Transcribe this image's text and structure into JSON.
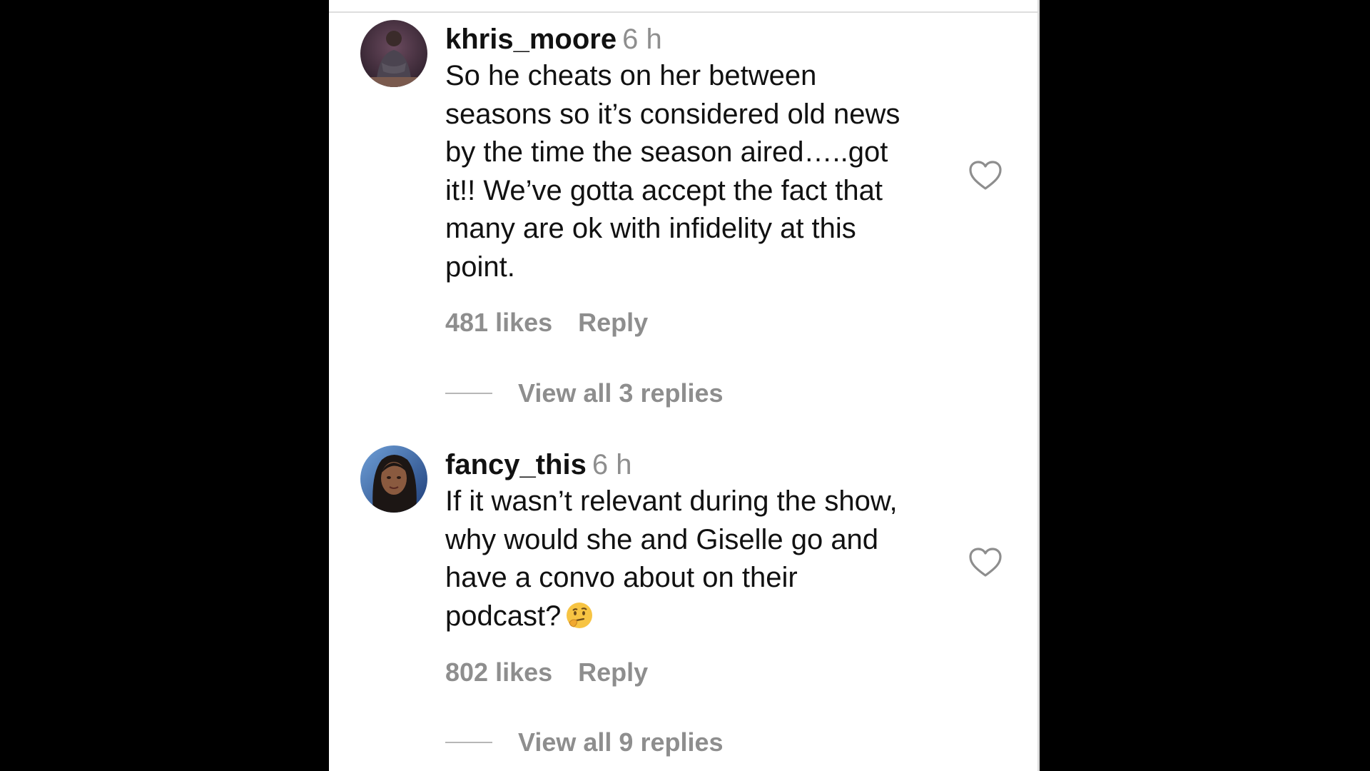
{
  "comments": [
    {
      "username": "khris_moore",
      "time": "6 h",
      "text_lines": [
        "So he cheats on her between",
        "seasons so it’s considered old news",
        "by the time the season aired…..got",
        "it!! We’ve gotta accept the fact that",
        "many are ok with infidelity at this",
        "point."
      ],
      "likes": "481 likes",
      "reply_label": "Reply",
      "view_replies": "View all 3 replies"
    },
    {
      "username": "fancy_this",
      "time": "6 h",
      "text_lines": [
        "If it wasn’t relevant during the show,",
        "why would she and Giselle go and",
        "have a convo about on their",
        "podcast?"
      ],
      "emoji": "thinking-face-emoji",
      "likes": "802 likes",
      "reply_label": "Reply",
      "view_replies": "View all 9 replies"
    }
  ],
  "icons": {
    "like": "heart-outline-icon"
  },
  "colors": {
    "background": "#000000",
    "panel": "#ffffff",
    "text": "#111111",
    "muted": "#8e8e8e"
  }
}
